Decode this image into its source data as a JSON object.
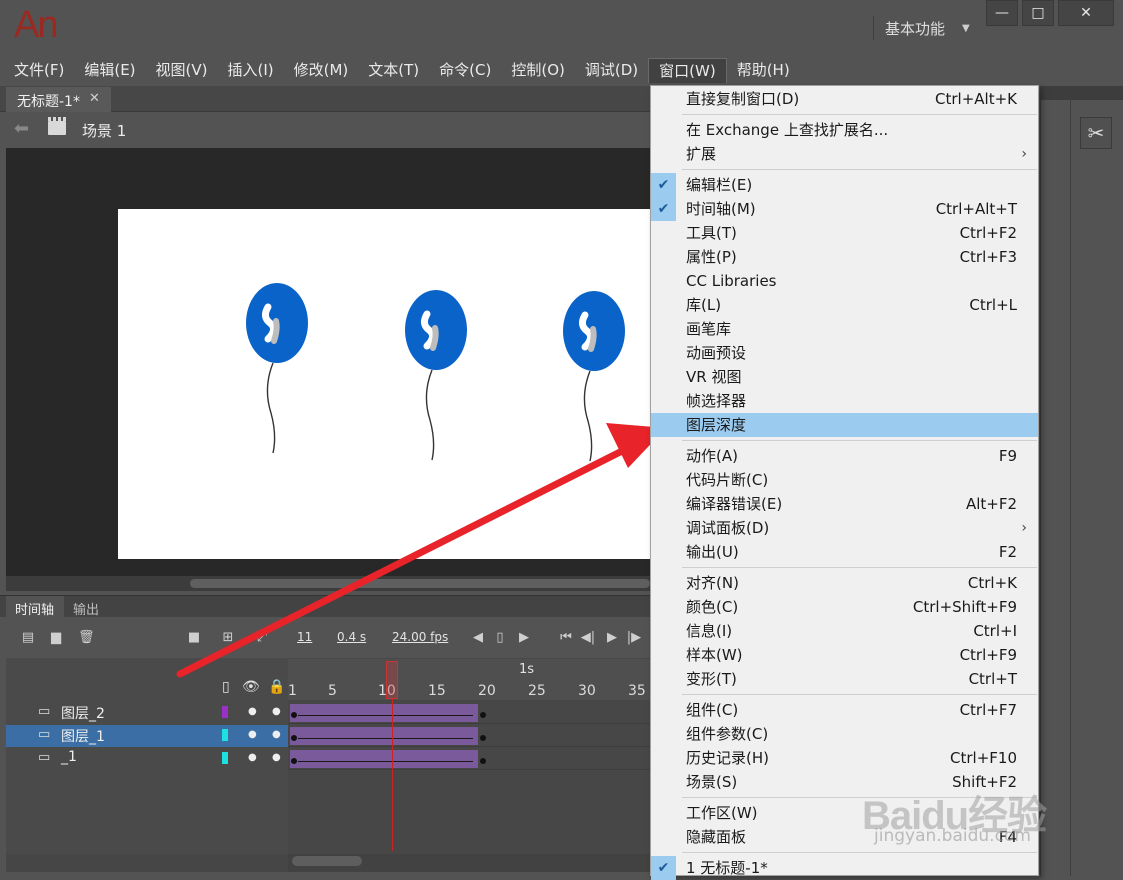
{
  "app": {
    "logo": "An",
    "workspace": "基本功能"
  },
  "window_controls": {
    "minimize": "—",
    "maximize": "□",
    "close": "✕"
  },
  "menubar": [
    "文件(F)",
    "编辑(E)",
    "视图(V)",
    "插入(I)",
    "修改(M)",
    "文本(T)",
    "命令(C)",
    "控制(O)",
    "调试(D)",
    "窗口(W)",
    "帮助(H)"
  ],
  "menubar_active_index": 9,
  "document_tab": {
    "title": "无标题-1*",
    "close": "✕"
  },
  "scene": {
    "label": "场景 1"
  },
  "timeline": {
    "tabs": [
      "时间轴",
      "输出"
    ],
    "current_frame": "11",
    "time": "0.4 s",
    "fps": "24.00 fps",
    "second_marker": "1s",
    "ruler_ticks": [
      "1",
      "5",
      "10",
      "15",
      "20",
      "25",
      "30",
      "35"
    ],
    "layers": [
      {
        "name": "图层_2",
        "color": "#9b30c8",
        "selected": false
      },
      {
        "name": "图层_1",
        "color": "#1ee0e0",
        "selected": true
      },
      {
        "name": "_1",
        "color": "#1ee0e0",
        "selected": false
      }
    ]
  },
  "window_menu": {
    "items": [
      {
        "label": "直接复制窗口(D)",
        "shortcut": "Ctrl+Alt+K"
      },
      {
        "sep": true
      },
      {
        "label": "在 Exchange 上查找扩展名..."
      },
      {
        "label": "扩展",
        "submenu": "›"
      },
      {
        "sep": true
      },
      {
        "label": "编辑栏(E)",
        "checked": true
      },
      {
        "label": "时间轴(M)",
        "shortcut": "Ctrl+Alt+T",
        "checked": true
      },
      {
        "label": "工具(T)",
        "shortcut": "Ctrl+F2"
      },
      {
        "label": "属性(P)",
        "shortcut": "Ctrl+F3"
      },
      {
        "label": "CC Libraries"
      },
      {
        "label": "库(L)",
        "shortcut": "Ctrl+L"
      },
      {
        "label": "画笔库"
      },
      {
        "label": "动画预设"
      },
      {
        "label": "VR 视图"
      },
      {
        "label": "帧选择器"
      },
      {
        "label": "图层深度",
        "highlighted": true
      },
      {
        "sep": true
      },
      {
        "label": "动作(A)",
        "shortcut": "F9"
      },
      {
        "label": "代码片断(C)"
      },
      {
        "label": "编译器错误(E)",
        "shortcut": "Alt+F2"
      },
      {
        "label": "调试面板(D)",
        "submenu": "›"
      },
      {
        "label": "输出(U)",
        "shortcut": "F2"
      },
      {
        "sep": true
      },
      {
        "label": "对齐(N)",
        "shortcut": "Ctrl+K"
      },
      {
        "label": "颜色(C)",
        "shortcut": "Ctrl+Shift+F9"
      },
      {
        "label": "信息(I)",
        "shortcut": "Ctrl+I"
      },
      {
        "label": "样本(W)",
        "shortcut": "Ctrl+F9"
      },
      {
        "label": "变形(T)",
        "shortcut": "Ctrl+T"
      },
      {
        "sep": true
      },
      {
        "label": "组件(C)",
        "shortcut": "Ctrl+F7"
      },
      {
        "label": "组件参数(C)"
      },
      {
        "label": "历史记录(H)",
        "shortcut": "Ctrl+F10"
      },
      {
        "label": "场景(S)",
        "shortcut": "Shift+F2"
      },
      {
        "sep": true
      },
      {
        "label": "工作区(W)"
      },
      {
        "label": "隐藏面板",
        "shortcut": "F4"
      },
      {
        "sep": true
      },
      {
        "label": "1 无标题-1*",
        "checked": true
      }
    ]
  },
  "watermark": {
    "logo": "Baidu经验",
    "url": "jingyan.baidu.com"
  },
  "colors": {
    "balloon": "#0a63c8",
    "highlight": "#9ccbf0",
    "annotation_arrow": "#e8232a"
  }
}
